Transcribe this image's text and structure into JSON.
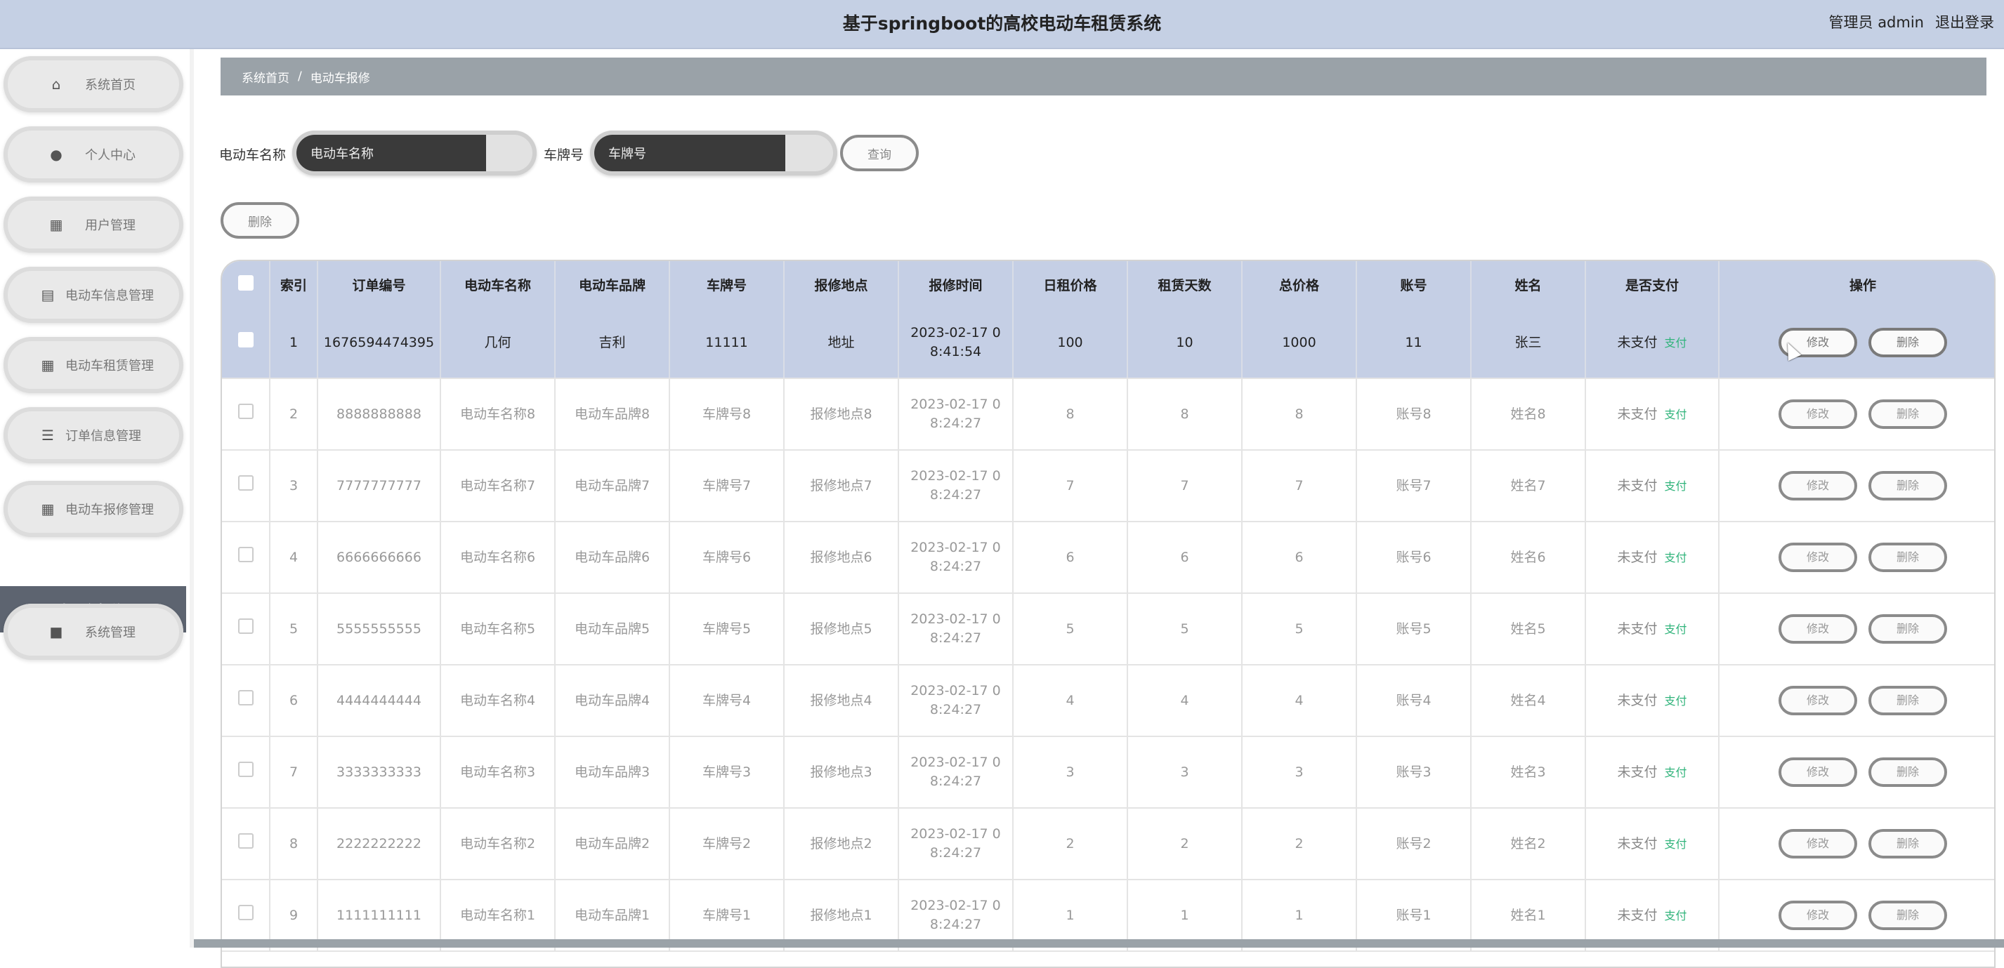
{
  "header": {
    "title": "基于springboot的高校电动车租赁系统",
    "user_label": "管理员 admin",
    "logout": "退出登录"
  },
  "sidebar": {
    "items": [
      {
        "label": "系统首页",
        "icon": "home-icon"
      },
      {
        "label": "个人中心",
        "icon": "user-icon"
      },
      {
        "label": "用户管理",
        "icon": "grid-icon"
      },
      {
        "label": "电动车信息管理",
        "icon": "table-icon"
      },
      {
        "label": "电动车租赁管理",
        "icon": "grid-icon"
      },
      {
        "label": "订单信息管理",
        "icon": "sliders-icon"
      },
      {
        "label": "电动车报修管理",
        "icon": "grid-icon"
      },
      {
        "label": "系统管理",
        "icon": "box-icon"
      }
    ],
    "active_sub": "电动车报修"
  },
  "breadcrumb": {
    "home": "系统首页",
    "separator": "/",
    "current": "电动车报修"
  },
  "search": {
    "name_label": "电动车名称",
    "name_placeholder": "电动车名称",
    "plate_label": "车牌号",
    "plate_placeholder": "车牌号",
    "query_button": "查询"
  },
  "toolbar": {
    "delete_button": "删除"
  },
  "table": {
    "columns": [
      "索引",
      "订单编号",
      "电动车名称",
      "电动车品牌",
      "车牌号",
      "报修地点",
      "报修时间",
      "日租价格",
      "租赁天数",
      "总价格",
      "账号",
      "姓名",
      "是否支付",
      "操作"
    ],
    "rows": [
      {
        "index": "1",
        "order": "1676594474395",
        "name": "几何",
        "brand": "吉利",
        "plate": "11111",
        "location": "地址",
        "time1": "2023-02-17 0",
        "time2": "8:41:54",
        "daily": "100",
        "days": "10",
        "total": "1000",
        "account": "11",
        "person": "张三",
        "pay": "未支付",
        "pay_link": "支付",
        "edit": "修改",
        "del": "删除"
      },
      {
        "index": "2",
        "order": "8888888888",
        "name": "电动车名称8",
        "brand": "电动车品牌8",
        "plate": "车牌号8",
        "location": "报修地点8",
        "time1": "2023-02-17 0",
        "time2": "8:24:27",
        "daily": "8",
        "days": "8",
        "total": "8",
        "account": "账号8",
        "person": "姓名8",
        "pay": "未支付",
        "pay_link": "支付",
        "edit": "修改",
        "del": "删除"
      },
      {
        "index": "3",
        "order": "7777777777",
        "name": "电动车名称7",
        "brand": "电动车品牌7",
        "plate": "车牌号7",
        "location": "报修地点7",
        "time1": "2023-02-17 0",
        "time2": "8:24:27",
        "daily": "7",
        "days": "7",
        "total": "7",
        "account": "账号7",
        "person": "姓名7",
        "pay": "未支付",
        "pay_link": "支付",
        "edit": "修改",
        "del": "删除"
      },
      {
        "index": "4",
        "order": "6666666666",
        "name": "电动车名称6",
        "brand": "电动车品牌6",
        "plate": "车牌号6",
        "location": "报修地点6",
        "time1": "2023-02-17 0",
        "time2": "8:24:27",
        "daily": "6",
        "days": "6",
        "total": "6",
        "account": "账号6",
        "person": "姓名6",
        "pay": "未支付",
        "pay_link": "支付",
        "edit": "修改",
        "del": "删除"
      },
      {
        "index": "5",
        "order": "5555555555",
        "name": "电动车名称5",
        "brand": "电动车品牌5",
        "plate": "车牌号5",
        "location": "报修地点5",
        "time1": "2023-02-17 0",
        "time2": "8:24:27",
        "daily": "5",
        "days": "5",
        "total": "5",
        "account": "账号5",
        "person": "姓名5",
        "pay": "未支付",
        "pay_link": "支付",
        "edit": "修改",
        "del": "删除"
      },
      {
        "index": "6",
        "order": "4444444444",
        "name": "电动车名称4",
        "brand": "电动车品牌4",
        "plate": "车牌号4",
        "location": "报修地点4",
        "time1": "2023-02-17 0",
        "time2": "8:24:27",
        "daily": "4",
        "days": "4",
        "total": "4",
        "account": "账号4",
        "person": "姓名4",
        "pay": "未支付",
        "pay_link": "支付",
        "edit": "修改",
        "del": "删除"
      },
      {
        "index": "7",
        "order": "3333333333",
        "name": "电动车名称3",
        "brand": "电动车品牌3",
        "plate": "车牌号3",
        "location": "报修地点3",
        "time1": "2023-02-17 0",
        "time2": "8:24:27",
        "daily": "3",
        "days": "3",
        "total": "3",
        "account": "账号3",
        "person": "姓名3",
        "pay": "未支付",
        "pay_link": "支付",
        "edit": "修改",
        "del": "删除"
      },
      {
        "index": "8",
        "order": "2222222222",
        "name": "电动车名称2",
        "brand": "电动车品牌2",
        "plate": "车牌号2",
        "location": "报修地点2",
        "time1": "2023-02-17 0",
        "time2": "8:24:27",
        "daily": "2",
        "days": "2",
        "total": "2",
        "account": "账号2",
        "person": "姓名2",
        "pay": "未支付",
        "pay_link": "支付",
        "edit": "修改",
        "del": "删除"
      },
      {
        "index": "9",
        "order": "1111111111",
        "name": "电动车名称1",
        "brand": "电动车品牌1",
        "plate": "车牌号1",
        "location": "报修地点1",
        "time1": "2023-02-17 0",
        "time2": "8:24:27",
        "daily": "1",
        "days": "1",
        "total": "1",
        "account": "账号1",
        "person": "姓名1",
        "pay": "未支付",
        "pay_link": "支付",
        "edit": "修改",
        "del": "删除"
      }
    ]
  }
}
